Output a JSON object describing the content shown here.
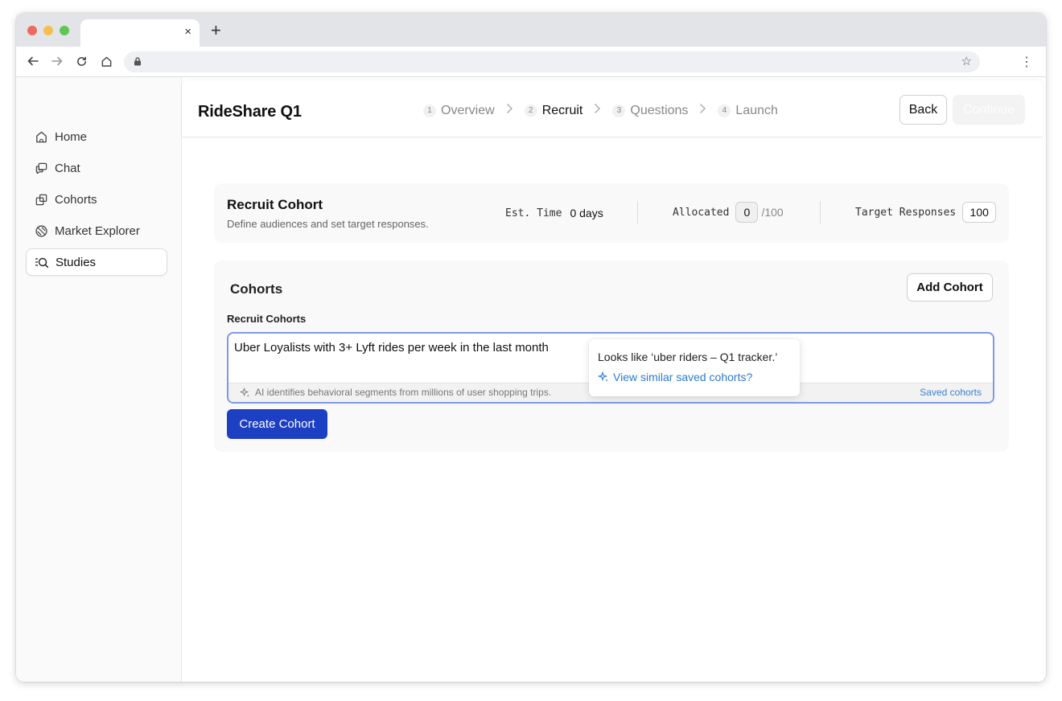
{
  "browser": {
    "tab_close": "×",
    "new_tab": "+"
  },
  "sidebar": {
    "items": [
      {
        "label": "Home",
        "icon": "home-icon"
      },
      {
        "label": "Chat",
        "icon": "chat-icon"
      },
      {
        "label": "Cohorts",
        "icon": "cohorts-icon"
      },
      {
        "label": "Market Explorer",
        "icon": "market-explorer-icon"
      },
      {
        "label": "Studies",
        "icon": "studies-icon",
        "active": true
      }
    ]
  },
  "header": {
    "title": "RideShare Q1",
    "steps": [
      {
        "num": "1",
        "label": "Overview"
      },
      {
        "num": "2",
        "label": "Recruit",
        "active": true
      },
      {
        "num": "3",
        "label": "Questions"
      },
      {
        "num": "4",
        "label": "Launch"
      }
    ],
    "back_label": "Back",
    "continue_label": "Continue"
  },
  "recruit": {
    "title": "Recruit Cohort",
    "subtitle": "Define audiences and set target responses.",
    "est_time_label": "Est. Time",
    "est_time_value": "0 days",
    "allocated_label": "Allocated",
    "allocated_value": "0",
    "allocated_total": "/100",
    "target_label": "Target Responses",
    "target_value": "100"
  },
  "cohorts": {
    "title": "Cohorts",
    "add_label": "Add Cohort",
    "field_label": "Recruit Cohorts",
    "input_value": "Uber Loyalists with 3+ Lyft rides per week in the last month",
    "hint": "AI identifies behavioral segments from millions of user shopping trips.",
    "saved_link": "Saved cohorts",
    "create_label": "Create Cohort"
  },
  "popover": {
    "text": "Looks like ‘uber riders – Q1 tracker.’",
    "link": "View similar saved cohorts?"
  },
  "colors": {
    "primary": "#1d3fc2",
    "link": "#2b7bd0",
    "focus_border": "#7d9ae6"
  }
}
